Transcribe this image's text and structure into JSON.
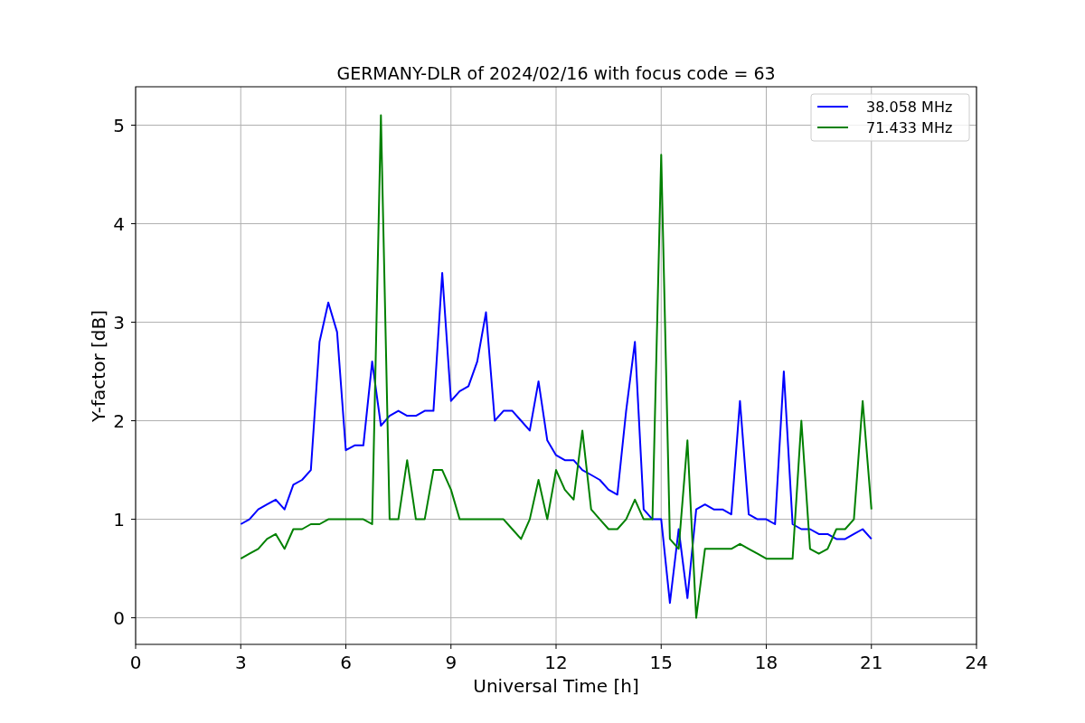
{
  "chart_data": {
    "type": "line",
    "title": "GERMANY-DLR of 2024/02/16 with focus code = 63",
    "xlabel": "Universal Time [h]",
    "ylabel": "Y-factor [dB]",
    "x": [
      3,
      3.25,
      3.5,
      3.75,
      4,
      4.25,
      4.5,
      4.75,
      5,
      5.25,
      5.5,
      5.75,
      6,
      6.25,
      6.5,
      6.75,
      7,
      7.25,
      7.5,
      7.75,
      8,
      8.25,
      8.5,
      8.75,
      9,
      9.25,
      9.5,
      9.75,
      10,
      10.25,
      10.5,
      10.75,
      11,
      11.25,
      11.5,
      11.75,
      12,
      12.25,
      12.5,
      12.75,
      13,
      13.25,
      13.5,
      13.75,
      14,
      14.25,
      14.5,
      14.75,
      15,
      15.25,
      15.5,
      15.75,
      16,
      16.25,
      16.5,
      16.75,
      17,
      17.25,
      17.5,
      17.75,
      18,
      18.25,
      18.5,
      18.75,
      19,
      19.25,
      19.5,
      19.75,
      20,
      20.25,
      20.5,
      20.75,
      21
    ],
    "series": [
      {
        "name": "38.058 MHz",
        "color": "#0000ff",
        "values": [
          0.95,
          1.0,
          1.1,
          1.15,
          1.2,
          1.1,
          1.35,
          1.4,
          1.5,
          2.8,
          3.2,
          2.9,
          1.7,
          1.75,
          1.75,
          2.6,
          1.95,
          2.05,
          2.1,
          2.05,
          2.05,
          2.1,
          2.1,
          3.5,
          2.2,
          2.3,
          2.35,
          2.6,
          3.1,
          2.0,
          2.1,
          2.1,
          2.0,
          1.9,
          2.4,
          1.8,
          1.65,
          1.6,
          1.6,
          1.5,
          1.45,
          1.4,
          1.3,
          1.25,
          2.1,
          2.8,
          1.1,
          1.0,
          1.0,
          0.15,
          0.9,
          0.2,
          1.1,
          1.15,
          1.1,
          1.1,
          1.05,
          2.2,
          1.05,
          1.0,
          1.0,
          0.95,
          2.5,
          0.95,
          0.9,
          0.9,
          0.85,
          0.85,
          0.8,
          0.8,
          0.85,
          0.9,
          0.8
        ]
      },
      {
        "name": "71.433 MHz",
        "color": "#008000",
        "values": [
          0.6,
          0.65,
          0.7,
          0.8,
          0.85,
          0.7,
          0.9,
          0.9,
          0.95,
          0.95,
          1.0,
          1.0,
          1.0,
          1.0,
          1.0,
          0.95,
          5.1,
          1.0,
          1.0,
          1.6,
          1.0,
          1.0,
          1.5,
          1.5,
          1.3,
          1.0,
          1.0,
          1.0,
          1.0,
          1.0,
          1.0,
          0.9,
          0.8,
          1.0,
          1.4,
          1.0,
          1.5,
          1.3,
          1.2,
          1.9,
          1.1,
          1.0,
          0.9,
          0.9,
          1.0,
          1.2,
          1.0,
          1.0,
          4.7,
          0.8,
          0.7,
          1.8,
          0.0,
          0.7,
          0.7,
          0.7,
          0.7,
          0.75,
          0.7,
          0.65,
          0.6,
          0.6,
          0.6,
          0.6,
          2.0,
          0.7,
          0.65,
          0.7,
          0.9,
          0.9,
          1.0,
          2.2,
          1.1
        ]
      }
    ],
    "xlim": [
      0,
      24
    ],
    "ylim": [
      -0.27,
      5.39
    ],
    "xticks": [
      0,
      3,
      6,
      9,
      12,
      15,
      18,
      21,
      24
    ],
    "yticks": [
      0,
      1,
      2,
      3,
      4,
      5
    ],
    "grid": true,
    "legend": "upper right"
  }
}
